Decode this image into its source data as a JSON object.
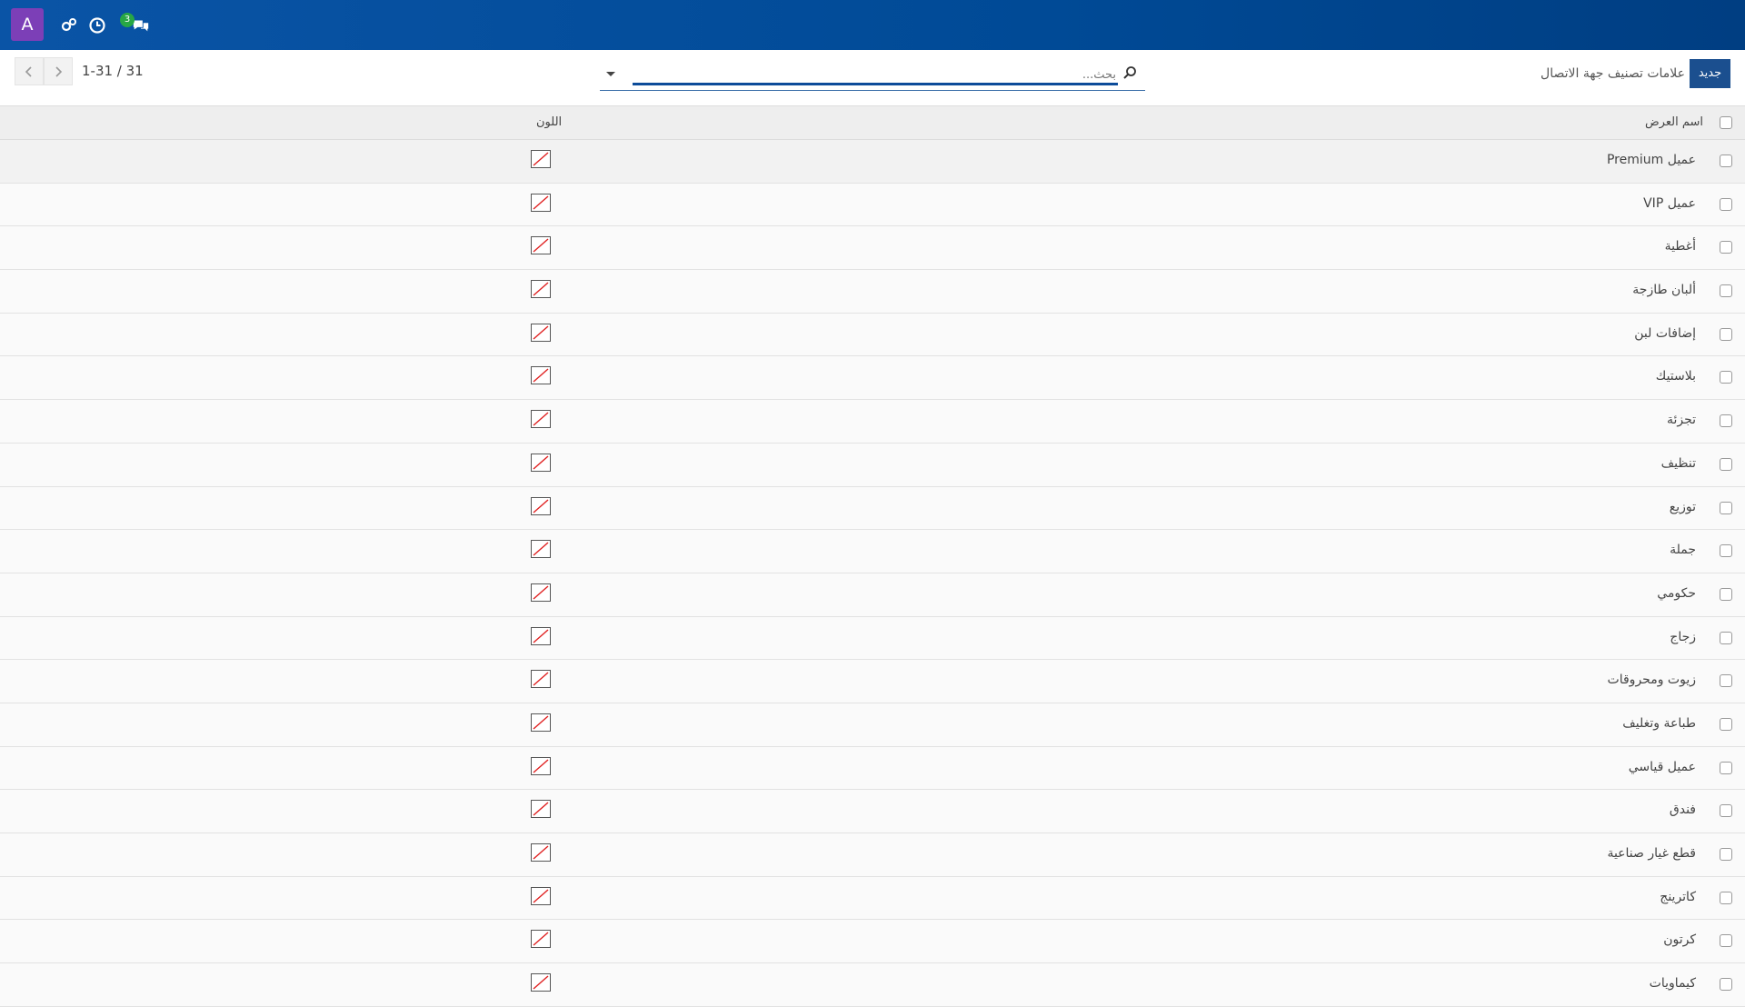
{
  "navbar": {
    "user_initial": "A",
    "chat_badge_count": "3",
    "icons": [
      "settings-icon",
      "clock-icon",
      "chat-icon"
    ]
  },
  "control_panel": {
    "new_button": "جديد",
    "breadcrumb": "علامات تصنيف جهة الاتصال",
    "search_placeholder": "بحث...",
    "pager_value": "1-31 / 31"
  },
  "table": {
    "columns": {
      "display_name": "اسم العرض",
      "color": "اللون"
    },
    "rows": [
      {
        "name": "عميل Premium"
      },
      {
        "name": "عميل VIP"
      },
      {
        "name": "أغطية"
      },
      {
        "name": "ألبان طازجة"
      },
      {
        "name": "إضافات لبن"
      },
      {
        "name": "بلاستيك"
      },
      {
        "name": "تجزئة"
      },
      {
        "name": "تنظيف"
      },
      {
        "name": "توزيع"
      },
      {
        "name": "جملة"
      },
      {
        "name": "حكومي"
      },
      {
        "name": "زجاج"
      },
      {
        "name": "زيوت ومحروقات"
      },
      {
        "name": "طباعة وتغليف"
      },
      {
        "name": "عميل قياسي"
      },
      {
        "name": "فندق"
      },
      {
        "name": "قطع غيار صناعية"
      },
      {
        "name": "كاترينج"
      },
      {
        "name": "كرتون"
      },
      {
        "name": "كيماويات"
      }
    ]
  }
}
